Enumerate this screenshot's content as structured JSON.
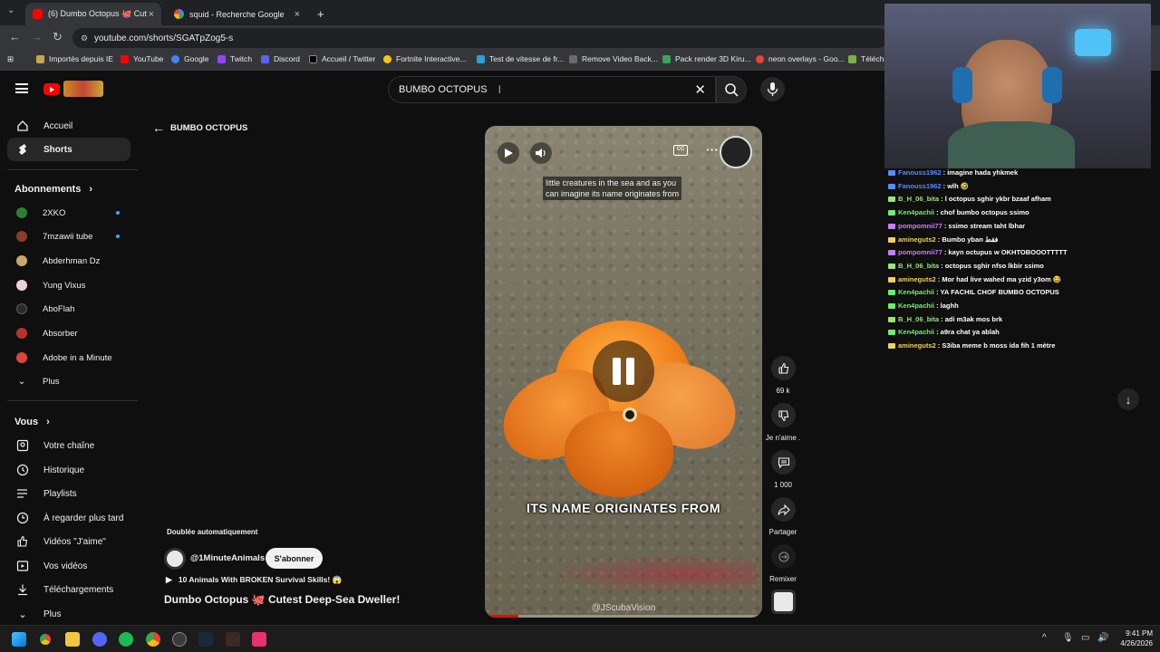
{
  "browser": {
    "tabs": [
      {
        "label": "(6) Dumbo Octopus 🐙 Cut",
        "close": "×"
      },
      {
        "label": "squid - Recherche Google",
        "close": "×"
      }
    ],
    "new_tab": "+",
    "url": "youtube.com/shorts/SGATpZog5-s",
    "bookmarks": [
      "Importés depuis IE",
      "YouTube",
      "Google",
      "Twitch",
      "Discord",
      "Accueil / Twitter",
      "Fortnite Interactive...",
      "Test de vitesse de fr...",
      "Remove Video Back...",
      "Pack render 3D Kiru...",
      "neon overlays - Goo...",
      "Télécha"
    ]
  },
  "youtube": {
    "search_value": "BUMBO OCTOPUS",
    "sidebar": {
      "main": [
        {
          "label": "Accueil",
          "icon": "home-icon"
        },
        {
          "label": "Shorts",
          "icon": "shorts-icon",
          "selected": true
        }
      ],
      "subs_title": "Abonnements",
      "subs": [
        {
          "label": "2XKO",
          "color": "#2e7d32",
          "dot": true
        },
        {
          "label": "7mzawii tube",
          "color": "#8d3b2a",
          "dot": true
        },
        {
          "label": "Abderhman Dz",
          "color": "#c9a86a",
          "dot": false
        },
        {
          "label": "Yung Vixus",
          "color": "#e8d4d4",
          "dot": false
        },
        {
          "label": "AboFlah",
          "color": "#2a2a2a",
          "dot": false
        },
        {
          "label": "Absorber",
          "color": "#b5352b",
          "dot": false
        },
        {
          "label": "Adobe in a Minute",
          "color": "#d9463a",
          "dot": false
        }
      ],
      "subs_more": "Plus",
      "you_title": "Vous",
      "you_items": [
        {
          "label": "Votre chaîne",
          "icon": "channel-icon"
        },
        {
          "label": "Historique",
          "icon": "history-icon"
        },
        {
          "label": "Playlists",
          "icon": "playlists-icon"
        },
        {
          "label": "À regarder plus tard",
          "icon": "watch-later-icon"
        },
        {
          "label": "Vidéos \"J'aime\"",
          "icon": "liked-icon"
        },
        {
          "label": "Vos vidéos",
          "icon": "your-videos-icon"
        },
        {
          "label": "Téléchargements",
          "icon": "download-icon"
        },
        {
          "label": "Plus",
          "icon": "chevron-down-icon"
        }
      ]
    },
    "back_label": "BUMBO OCTOPUS",
    "short": {
      "subtitle_line1": "little creatures in the sea and as you",
      "subtitle_line2": "can imagine its name originates from",
      "big_caption": "ITS NAME ORIGINATES FROM",
      "watermark": "@JScubaVision",
      "dubbed": "Doublée automatiquement",
      "channel": "@1MinuteAnimals",
      "subscribe": "S'abonner",
      "playlist": "10 Animals With BROKEN Survival Skills! 😱",
      "title": "Dumbo Octopus 🐙 Cutest Deep-Sea Dweller!",
      "progress": 0.12
    },
    "actions": {
      "likes": "69 k",
      "dislike": "Je n'aime .",
      "comments": "1 000",
      "share": "Partager",
      "remix": "Remixer"
    }
  },
  "chat": [
    {
      "user": "Fanouss1962",
      "msg": ": imagine hada yhkmek",
      "color": "#5b8bff"
    },
    {
      "user": "Fanouss1962",
      "msg": ": wlh 🤣",
      "color": "#5b8bff"
    },
    {
      "user": "B_H_06_bita",
      "msg": ": l octopus sghir ykbr bzaaf afham",
      "color": "#9be37a"
    },
    {
      "user": "Ken4pachii",
      "msg": ": chof bumbo octopus ssimo",
      "color": "#6cf06c"
    },
    {
      "user": "pompomnii77",
      "msg": ": ssimo stream taht lbhar",
      "color": "#c77dff"
    },
    {
      "user": "amineguts2",
      "msg": ": Bumbo yban فقط",
      "color": "#f0d060"
    },
    {
      "user": "pompomnii77",
      "msg": ": kayn octupus w OKHTOBOOOTTTTT",
      "color": "#c77dff"
    },
    {
      "user": "B_H_06_bita",
      "msg": ": octopus sghir nfso lkbir ssimo",
      "color": "#9be37a"
    },
    {
      "user": "amineguts2",
      "msg": ": Mor had live wahed ma yzid y3om 😂",
      "color": "#f0d060"
    },
    {
      "user": "Ken4pachii",
      "msg": ": YA FACHIL CHOF BUMBO OCTOPUS",
      "color": "#6cf06c"
    },
    {
      "user": "Ken4pachii",
      "msg": ": laghh",
      "color": "#6cf06c"
    },
    {
      "user": "B_H_06_bita",
      "msg": ": adi m3ak mos brk",
      "color": "#9be37a"
    },
    {
      "user": "Ken4pachii",
      "msg": ": a9ra chat ya ablah",
      "color": "#6cf06c"
    },
    {
      "user": "amineguts2",
      "msg": ": S3iba meme b moss ida fih 1 mètre",
      "color": "#f0d060"
    }
  ],
  "taskbar": {
    "time": "9:41 PM",
    "date": "4/26/2026"
  }
}
